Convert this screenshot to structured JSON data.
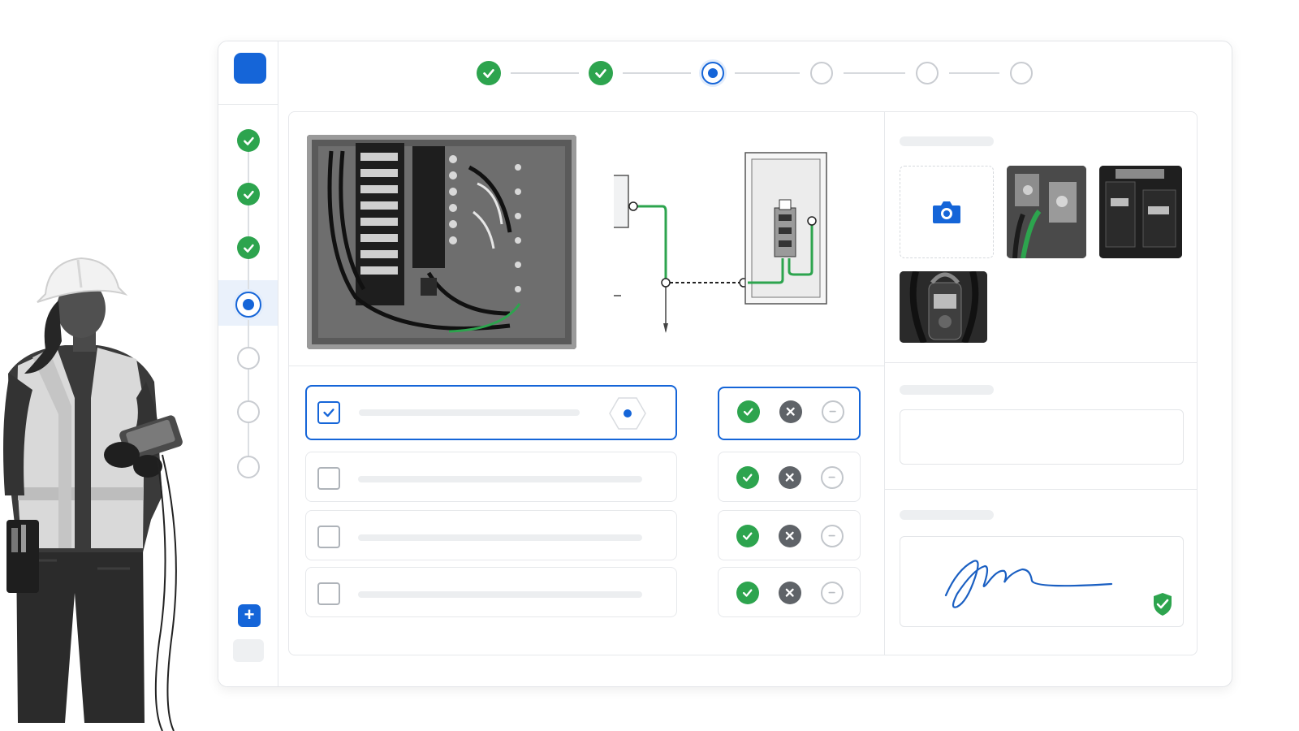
{
  "theme": {
    "accent": "#1565d8",
    "success": "#2da44e",
    "reject": "#5f6368",
    "muted": "#c9ccd1"
  },
  "rail": {
    "logo": "app-logo",
    "steps": [
      "done",
      "done",
      "done",
      "current",
      "todo",
      "todo",
      "todo"
    ],
    "add_label": "+"
  },
  "stepper": {
    "steps": [
      "done",
      "done",
      "current",
      "todo",
      "todo",
      "todo"
    ]
  },
  "inspection": {
    "photo": "electrical-panel-photo",
    "diagram": "grounding-electrode-diagram"
  },
  "checklist": {
    "rows": [
      {
        "checked": true,
        "selected": true,
        "icon": "target-hex-icon"
      },
      {
        "checked": false,
        "selected": false
      },
      {
        "checked": false,
        "selected": false
      },
      {
        "checked": false,
        "selected": false
      }
    ],
    "actions": [
      "pass-icon",
      "fail-icon",
      "not-applicable-icon"
    ]
  },
  "media": {
    "upload_icon": "camera-icon",
    "thumbnails": [
      "busbar-closeup",
      "breaker-closeup",
      "clamp-meter-reading"
    ]
  },
  "signature": {
    "verified_icon": "shield-check-icon"
  }
}
